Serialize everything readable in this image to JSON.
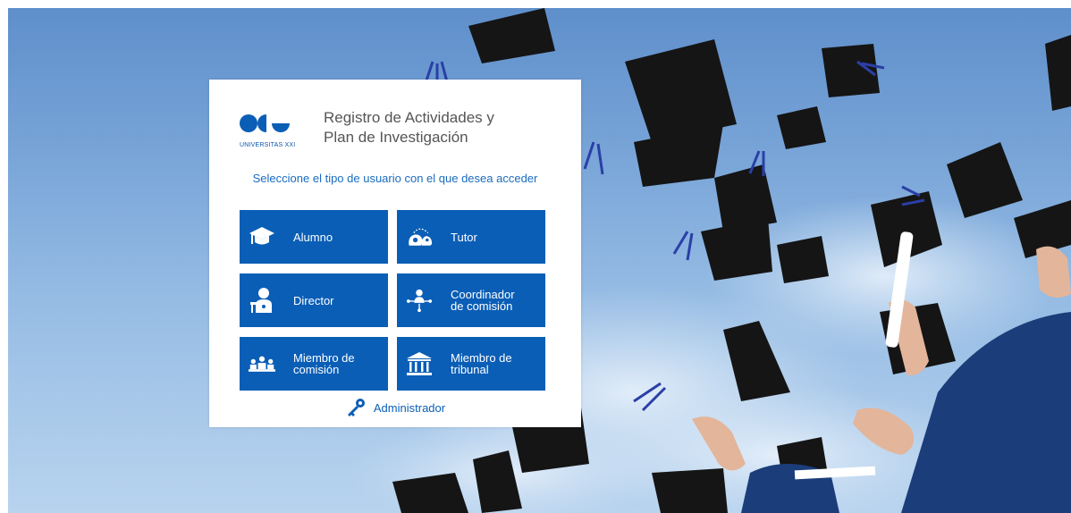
{
  "brand": {
    "caption": "UNIVERSITAS XXI"
  },
  "header": {
    "title_line1": "Registro de Actividades y",
    "title_line2": "Plan de Investigación"
  },
  "prompt": "Seleccione el tipo de usuario con el que desea acceder",
  "tiles": [
    {
      "line1": "Alumno",
      "line2": "",
      "icon": "graduation-cap-icon"
    },
    {
      "line1": "Tutor",
      "line2": "",
      "icon": "mentoring-heads-icon"
    },
    {
      "line1": "Director",
      "line2": "",
      "icon": "teacher-icon"
    },
    {
      "line1": "Coordinador",
      "line2": "de comisión",
      "icon": "network-person-icon"
    },
    {
      "line1": "Miembro de",
      "line2": "comisión",
      "icon": "committee-icon"
    },
    {
      "line1": "Miembro de",
      "line2": "tribunal",
      "icon": "courthouse-icon"
    }
  ],
  "admin": {
    "label": "Administrador",
    "icon": "keys-icon"
  },
  "colors": {
    "primary": "#0a5eb6",
    "prompt": "#1a6cc0",
    "title": "#555555",
    "sky": "#79a5d8"
  }
}
